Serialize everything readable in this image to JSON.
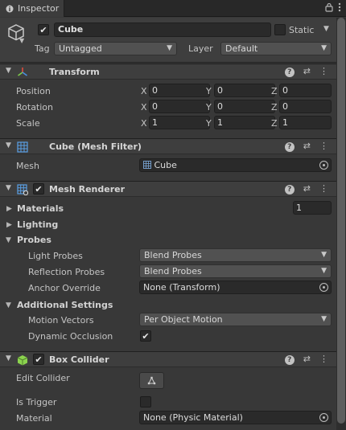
{
  "window": {
    "tab_label": "Inspector",
    "tab_icon": "info-icon",
    "lock_icon": "lock-icon",
    "menu_icon": "kebab-menu-icon"
  },
  "gameobject": {
    "active": true,
    "name": "Cube",
    "static_label": "Static",
    "static_checked": false,
    "tag_label": "Tag",
    "tag_value": "Untagged",
    "layer_label": "Layer",
    "layer_value": "Default"
  },
  "transform": {
    "title": "Transform",
    "position_label": "Position",
    "rotation_label": "Rotation",
    "scale_label": "Scale",
    "axis_x": "X",
    "axis_y": "Y",
    "axis_z": "Z",
    "position": {
      "x": "0",
      "y": "0",
      "z": "0"
    },
    "rotation": {
      "x": "0",
      "y": "0",
      "z": "0"
    },
    "scale": {
      "x": "1",
      "y": "1",
      "z": "1"
    }
  },
  "mesh_filter": {
    "title": "Cube (Mesh Filter)",
    "mesh_label": "Mesh",
    "mesh_value": "Cube"
  },
  "mesh_renderer": {
    "title": "Mesh Renderer",
    "enabled": true,
    "materials_label": "Materials",
    "materials_count": "1",
    "lighting_label": "Lighting",
    "probes_label": "Probes",
    "light_probes_label": "Light Probes",
    "light_probes_value": "Blend Probes",
    "reflection_probes_label": "Reflection Probes",
    "reflection_probes_value": "Blend Probes",
    "anchor_override_label": "Anchor Override",
    "anchor_override_value": "None (Transform)",
    "additional_settings_label": "Additional Settings",
    "motion_vectors_label": "Motion Vectors",
    "motion_vectors_value": "Per Object Motion",
    "dynamic_occlusion_label": "Dynamic Occlusion",
    "dynamic_occlusion_checked": true
  },
  "box_collider": {
    "title": "Box Collider",
    "enabled": true,
    "edit_collider_label": "Edit Collider",
    "is_trigger_label": "Is Trigger",
    "is_trigger_checked": false,
    "material_label": "Material",
    "material_value": "None (Physic Material)"
  },
  "colors": {
    "transform_icon_red": "#e04a3c",
    "transform_icon_green": "#7ecb4a",
    "transform_icon_blue": "#4a8fe0",
    "mesh_icon_blue": "#5aa0e6",
    "collider_icon_green": "#8bd34e"
  }
}
